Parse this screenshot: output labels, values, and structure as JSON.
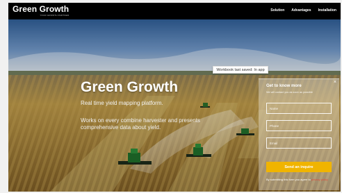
{
  "brand": {
    "title": "Green Growth",
    "tagline": "YOUR GROWTH PARTNER"
  },
  "nav": {
    "items": [
      {
        "label": "Solution"
      },
      {
        "label": "Advantages"
      },
      {
        "label": "Installation"
      }
    ]
  },
  "toast": {
    "text": "Workbook last saved: In app"
  },
  "hero": {
    "title": "Green Growth",
    "subtitle": "Real time yield mapping platform.",
    "description": "Works on every combine harvester and presents comprehensive data about yield."
  },
  "form": {
    "title": "Get to know more",
    "subtitle": "We will contact you as soon as possible",
    "fields": [
      {
        "placeholder": "Name"
      },
      {
        "placeholder": "Phone"
      },
      {
        "placeholder": "Email"
      }
    ],
    "submit_label": "Send an inquire",
    "consent_text": "By submitting this form you agree to ",
    "consent_link": "privacy policy"
  },
  "colors": {
    "navbar": "#000000",
    "accent": "#f0b400",
    "sky": "#4f7fb6",
    "field": "#b8923a"
  }
}
